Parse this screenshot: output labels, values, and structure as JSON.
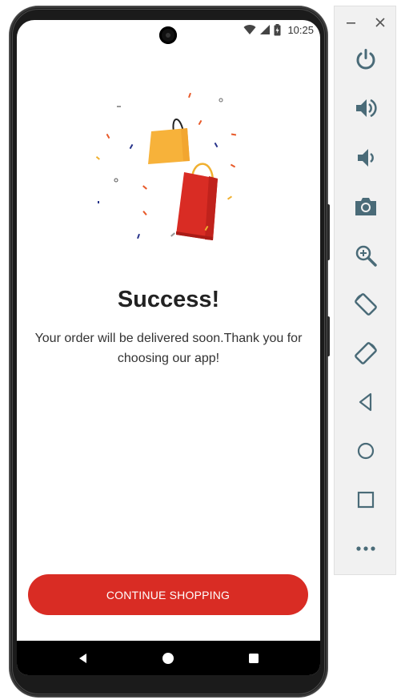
{
  "status_bar": {
    "time": "10:25",
    "icons": [
      "wifi-icon",
      "signal-icon",
      "battery-icon"
    ]
  },
  "success": {
    "title": "Success!",
    "message": "Your order will be delivered soon.Thank you for choosing our app!",
    "button_label": "CONTINUE SHOPPING"
  },
  "nav": {
    "items": [
      "back-icon",
      "home-icon",
      "recents-icon"
    ]
  },
  "emulator_panel": {
    "items": [
      "power-icon",
      "volume-up-icon",
      "volume-down-icon",
      "camera-icon",
      "zoom-icon",
      "rotate-left-icon",
      "rotate-right-icon",
      "back-icon",
      "home-icon",
      "overview-icon",
      "more-icon"
    ]
  },
  "colors": {
    "accent": "#d92c24",
    "bag_yellow": "#f7b23a",
    "bag_red": "#d92c24",
    "panel_icon": "#4a6b78"
  }
}
